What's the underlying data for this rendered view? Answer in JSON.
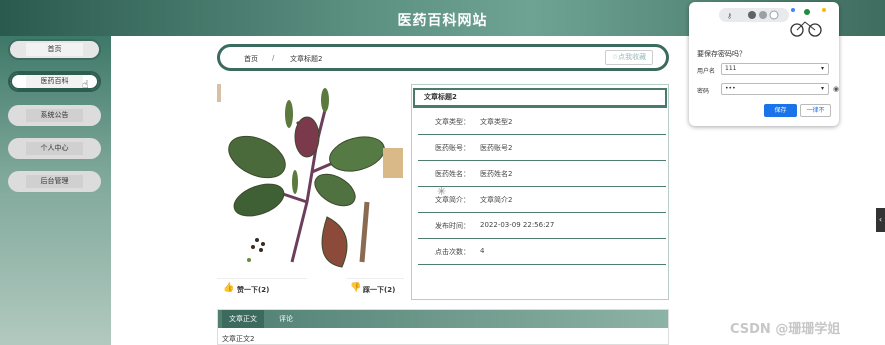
{
  "header": {
    "title": "医药百科网站"
  },
  "sidebar": {
    "items": [
      {
        "label": "首页"
      },
      {
        "label": "医药百科"
      },
      {
        "label": "系统公告"
      },
      {
        "label": "个人中心"
      },
      {
        "label": "后台管理"
      }
    ]
  },
  "breadcrumb": {
    "home": "首页",
    "separator": "/",
    "current": "文章标题2"
  },
  "favorite_button": {
    "label": "☆点我收藏"
  },
  "votes": {
    "like_label": "赞一下(2)",
    "dislike_label": "踩一下(2)"
  },
  "info": {
    "title": "文章标题2",
    "rows": [
      {
        "key": "文章类型：",
        "value": "文章类型2"
      },
      {
        "key": "医药账号：",
        "value": "医药账号2"
      },
      {
        "key": "医药姓名：",
        "value": "医药姓名2"
      },
      {
        "key": "文章简介：",
        "value": "文章简介2"
      },
      {
        "key": "发布时间：",
        "value": "2022-03-09 22:56:27"
      },
      {
        "key": "点击次数：",
        "value": "4"
      }
    ]
  },
  "tabs": {
    "items": [
      {
        "label": "文章正文"
      },
      {
        "label": "评论"
      }
    ],
    "body": "文章正文2"
  },
  "password_popup": {
    "question": "要保存密码吗？",
    "username_label": "用户名",
    "username_value": "111",
    "password_label": "密码",
    "password_value": "•••",
    "save_label": "保存",
    "never_label": "一律不"
  },
  "watermark": "CSDN @珊珊学姐",
  "colors": {
    "primary": "#3d6b5f",
    "header_mid": "#6ea393",
    "like": "#cc4444",
    "popup_button": "#1a73e8"
  }
}
